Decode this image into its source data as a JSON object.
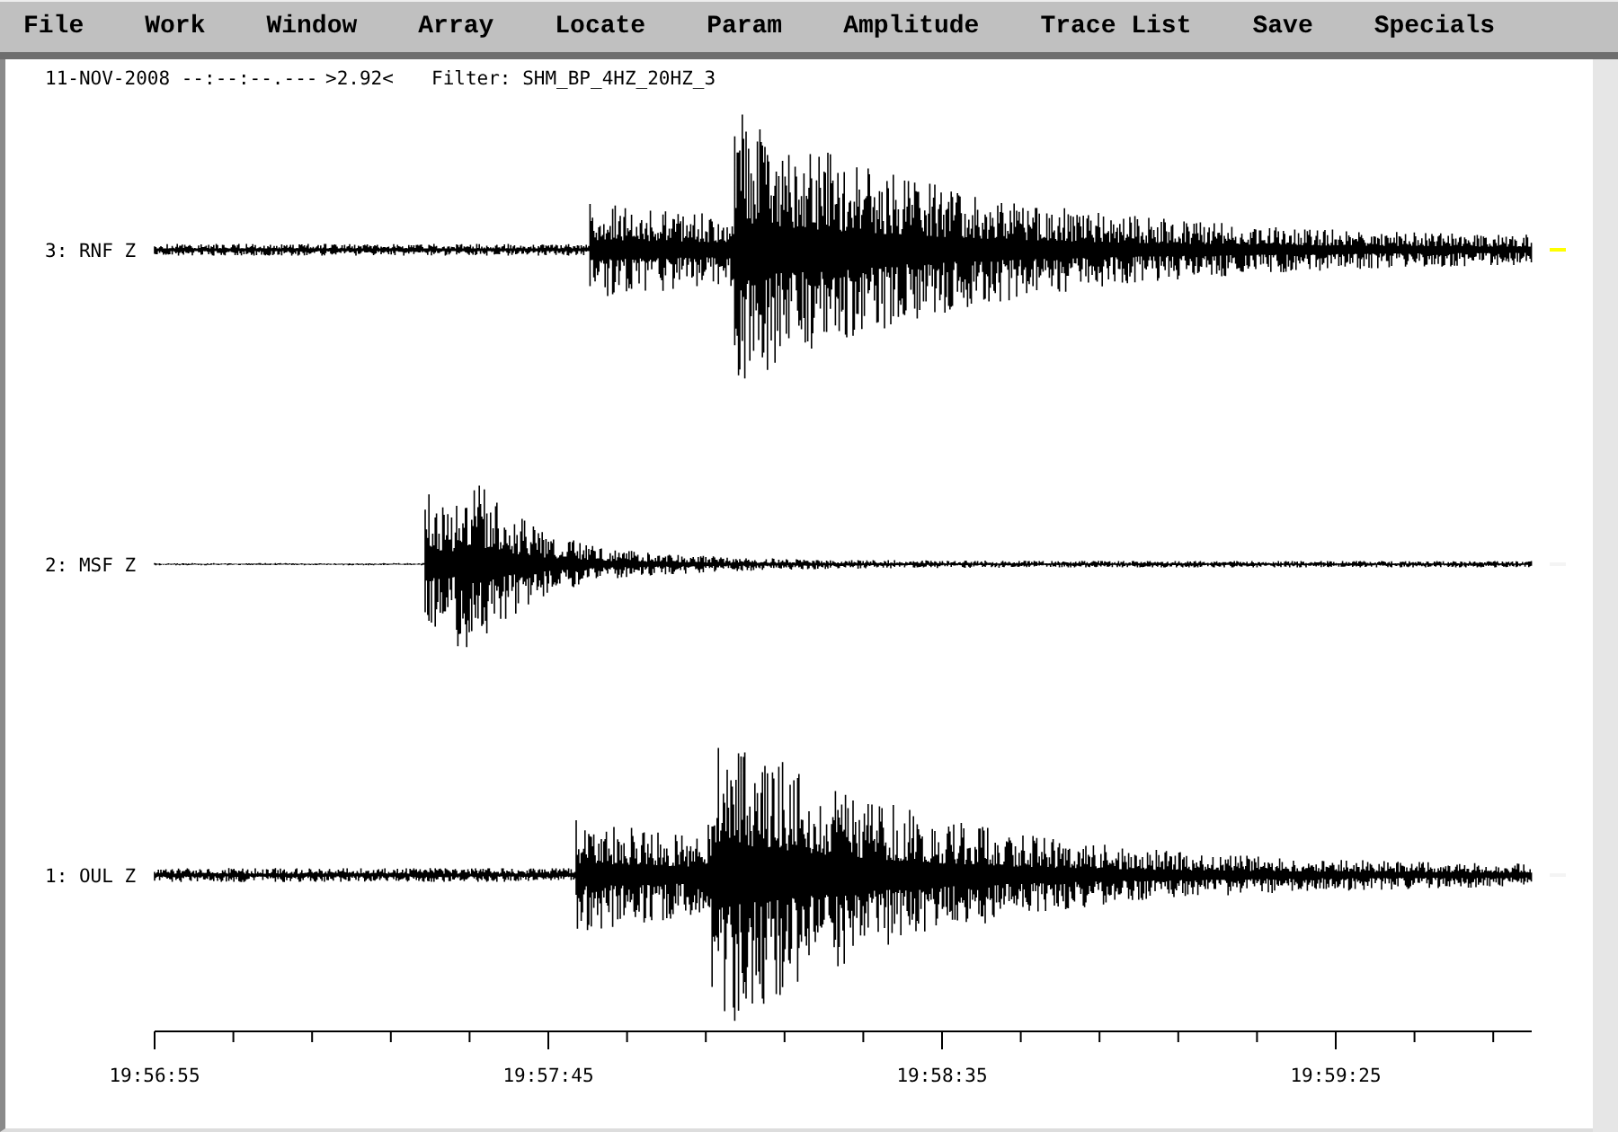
{
  "menu": [
    "File",
    "Work",
    "Window",
    "Array",
    "Locate",
    "Param",
    "Amplitude",
    "Trace List",
    "Save",
    "Specials"
  ],
  "header": {
    "date": "11-NOV-2008 --:--:--.---",
    "scale": ">2.92<",
    "filter": "Filter: SHM_BP_4HZ_20HZ_3"
  },
  "traces": [
    {
      "label": "3: RNF Z",
      "color": "#ffff00"
    },
    {
      "label": "2: MSF Z",
      "color": "#f4f4f4"
    },
    {
      "label": "1: OUL Z",
      "color": "#f4f4f4"
    }
  ],
  "axis": {
    "labels": [
      "19:56:55",
      "19:57:45",
      "19:58:35",
      "19:59:25"
    ]
  }
}
